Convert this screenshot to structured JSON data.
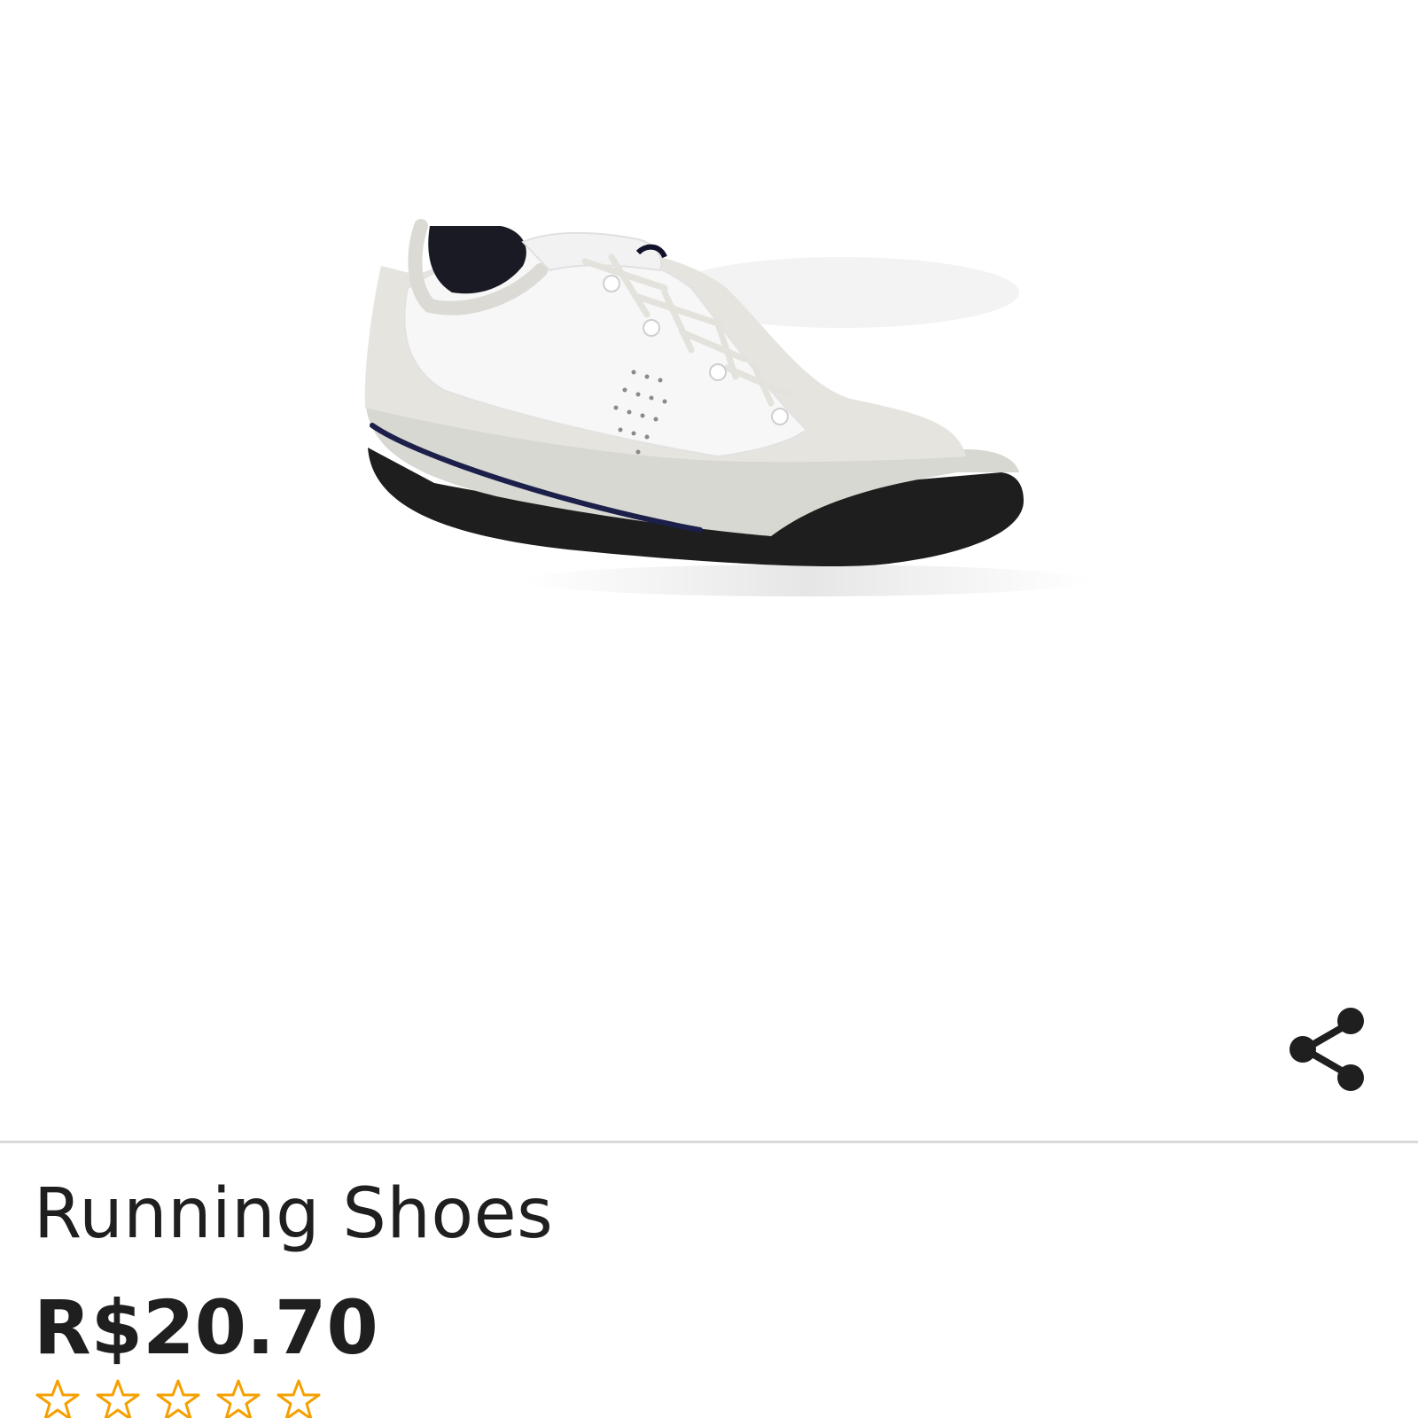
{
  "product": {
    "title": "Running Shoes",
    "price": "R$20.70",
    "image": {
      "icon": "running-shoe-image"
    },
    "rating": {
      "value": 0,
      "max": 5,
      "star_color": "#f5a000"
    }
  },
  "actions": {
    "share_icon": "share-icon"
  },
  "colors": {
    "text": "#1f1f1f",
    "divider": "#d9d9d9",
    "star": "#f5a000"
  }
}
